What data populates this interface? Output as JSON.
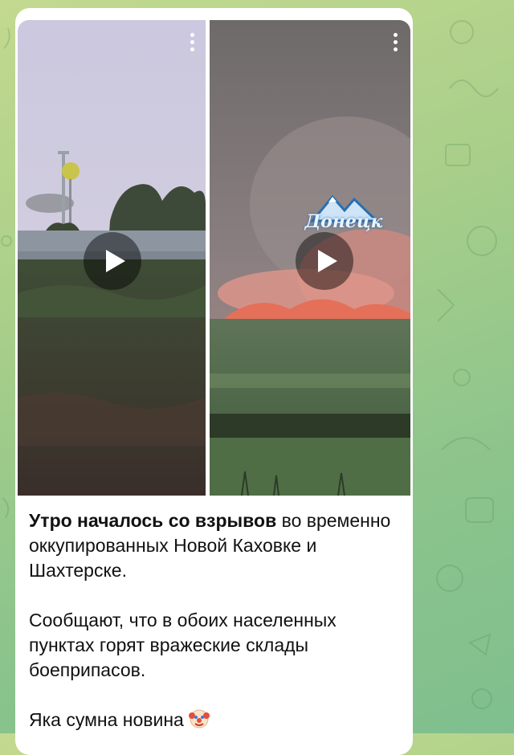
{
  "post": {
    "media": [
      {
        "kind": "video",
        "description_icon": "play-icon"
      },
      {
        "kind": "video",
        "watermark": "Донецк",
        "description_icon": "play-icon"
      }
    ],
    "caption": {
      "bold": "Утро началось со взрывов",
      "line1_rest": " во временно оккупированных Новой Каховке и Шахтерске.",
      "para2": "Сообщают, что в обоих населенных пунктах горят вражеские склады боеприпасов.",
      "para3": "Яка сумна новина",
      "emoji_icon": "clown-face-icon"
    }
  },
  "colors": {
    "bubble": "#ffffff",
    "wallpaper": "#9ccc8c"
  }
}
